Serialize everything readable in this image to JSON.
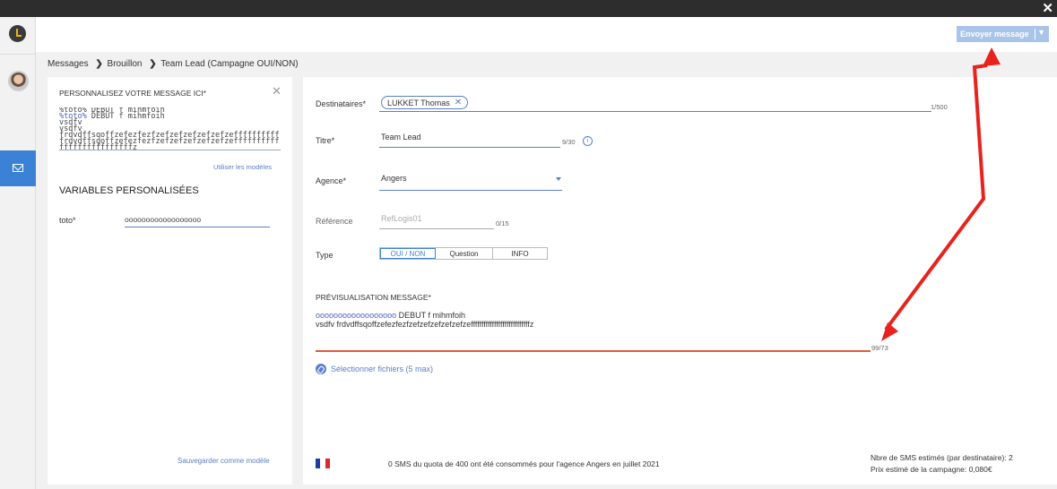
{
  "window": {
    "close_glyph": "✕"
  },
  "toolbar": {
    "send_label": "Envoyer message",
    "send_caret": "▼"
  },
  "breadcrumb": {
    "items": [
      "Messages",
      "Brouillon",
      "Team Lead (Campagne OUI/NON)"
    ],
    "separator": "❯"
  },
  "left": {
    "title": "PERSONNALISEZ VOTRE MESSAGE ICI*",
    "close": "✕",
    "message_var": "%toto%",
    "message_rest_1": " DEBUT f mihmfoih",
    "message_line_2a": "%toto%",
    "message_line_2b": " DEBUT f mihmfoih",
    "message_line_3": "vsdfv",
    "message_line_4": "vsdfv",
    "message_line_5": "frdvdffsqoffzefezfezfzefzefzefzefzefzeffffffffff",
    "message_line_6": "frdvdffsqoffzefezfezfzefzefzefzefzefzeffffffffff",
    "message_line_7": "ffffffffffffffffz",
    "use_models": "Utiliser les modèles",
    "vars_title": "VARIABLES PERSONALISÉES",
    "var_label": "toto*",
    "var_value": "oooooooooooooooooo",
    "save_model": "Sauvegarder comme modèle"
  },
  "form": {
    "recipients_label": "Destinataires*",
    "recipient_chip": "LUKKET Thomas",
    "recipient_chip_remove": "✕",
    "recipients_count": "1/500",
    "title_label": "Titre*",
    "title_value": "Team Lead",
    "title_count": "9/30",
    "info_glyph": "i",
    "agency_label": "Agence*",
    "agency_value": "Angers",
    "reference_label": "Référence",
    "reference_placeholder": "RefLogis01",
    "reference_count": "0/15",
    "type_label": "Type",
    "type_options": [
      "OUI / NON",
      "Question",
      "INFO"
    ],
    "preview_title": "PRÉVISUALISATION MESSAGE*",
    "preview_var": "oooooooooooooooooo",
    "preview_rest": " DEBUT f mihmfoih",
    "preview_line_2": "vsdfv frdvdffsqoffzefezfezfzefzefzefzefzefzeffffffffffffffffffffffffffffz",
    "preview_count": "99/73",
    "attach_label": "Sélectionner fichiers (5 max)"
  },
  "footer": {
    "quota_text": "0 SMS du quota de 400 ont été consommés pour l'agence Angers en juillet 2021",
    "sms_estimate": "Nbre de SMS estimés (par destinataire): 2",
    "price_estimate": "Prix estimé de la campagne: 0,080€"
  },
  "colors": {
    "accent": "#3b82d6",
    "send_disabled": "#a9c4ea",
    "error_line": "#e05a3a",
    "annotation_arrow": "#e8231e"
  },
  "icons": [
    "clock-icon",
    "avatar",
    "mail-icon",
    "info-icon",
    "paperclip-icon",
    "france-flag-icon",
    "close-icon",
    "dropdown-caret-icon"
  ]
}
